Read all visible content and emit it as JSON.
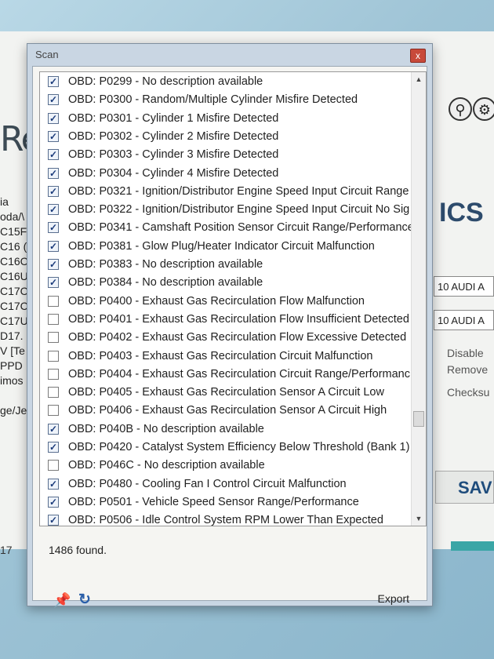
{
  "background_app": {
    "logo_text": "Re",
    "left_list": [
      "ia",
      "oda/\\",
      "C15F",
      "C16 (",
      "C16C",
      "C16U",
      "C17C",
      "C17C",
      "C17U",
      "D17.",
      "V [Te",
      "PPD",
      "imos",
      "",
      "ge/Jee"
    ],
    "left_bottom": "17",
    "right_ics": "ICS",
    "audi_field_1": "10 AUDI A",
    "audi_field_2": "10 AUDI A",
    "disable_label": "Disable",
    "remove_label": "Remove",
    "checksum_label": "Checksu",
    "save_label": "SAV"
  },
  "dialog": {
    "title": "Scan",
    "close_label": "x",
    "found_text": "1486 found.",
    "export_label": "Export"
  },
  "codes": [
    {
      "text": "OBD: P0299 - No description available",
      "checked": true
    },
    {
      "text": "OBD: P0300 - Random/Multiple Cylinder Misfire Detected",
      "checked": true
    },
    {
      "text": "OBD: P0301 - Cylinder 1 Misfire Detected",
      "checked": true
    },
    {
      "text": "OBD: P0302 - Cylinder 2 Misfire Detected",
      "checked": true
    },
    {
      "text": "OBD: P0303 - Cylinder 3 Misfire Detected",
      "checked": true
    },
    {
      "text": "OBD: P0304 - Cylinder 4 Misfire Detected",
      "checked": true
    },
    {
      "text": "OBD: P0321 - Ignition/Distributor Engine Speed Input Circuit Range",
      "checked": true
    },
    {
      "text": "OBD: P0322 - Ignition/Distributor Engine Speed Input Circuit No Sig",
      "checked": true
    },
    {
      "text": "OBD: P0341 - Camshaft Position Sensor Circuit Range/Performance",
      "checked": true
    },
    {
      "text": "OBD: P0381 - Glow Plug/Heater Indicator Circuit Malfunction",
      "checked": true
    },
    {
      "text": "OBD: P0383 - No description available",
      "checked": true
    },
    {
      "text": "OBD: P0384 - No description available",
      "checked": true
    },
    {
      "text": "OBD: P0400 - Exhaust Gas Recirculation Flow Malfunction",
      "checked": false
    },
    {
      "text": "OBD: P0401 - Exhaust Gas Recirculation Flow Insufficient Detected",
      "checked": false
    },
    {
      "text": "OBD: P0402 - Exhaust Gas Recirculation Flow Excessive Detected",
      "checked": false
    },
    {
      "text": "OBD: P0403 - Exhaust Gas Recirculation Circuit Malfunction",
      "checked": false
    },
    {
      "text": "OBD: P0404 - Exhaust Gas Recirculation Circuit Range/Performanc",
      "checked": false
    },
    {
      "text": "OBD: P0405 - Exhaust Gas Recirculation Sensor A Circuit Low",
      "checked": false
    },
    {
      "text": "OBD: P0406 - Exhaust Gas Recirculation Sensor A Circuit High",
      "checked": false
    },
    {
      "text": "OBD: P040B - No description available",
      "checked": true
    },
    {
      "text": "OBD: P0420 - Catalyst System Efficiency Below Threshold (Bank 1)",
      "checked": true
    },
    {
      "text": "OBD: P046C - No description available",
      "checked": false
    },
    {
      "text": "OBD: P0480 - Cooling Fan I Control Circuit Malfunction",
      "checked": true
    },
    {
      "text": "OBD: P0501 - Vehicle Speed Sensor Range/Performance",
      "checked": true
    },
    {
      "text": "OBD: P0506 - Idle Control System RPM Lower Than Expected",
      "checked": true
    }
  ],
  "icons": {
    "pin": "pin-icon",
    "refresh": "refresh-icon",
    "check": "check-icon"
  },
  "colors": {
    "accent": "#2a5ea8",
    "close": "#c84a3a"
  }
}
